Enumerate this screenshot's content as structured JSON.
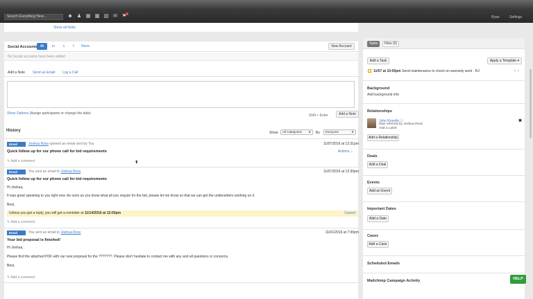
{
  "topbar": {
    "search_placeholder": "Search Everything Here...",
    "icons": [
      "person-add-icon",
      "people-icon",
      "building-icon",
      "briefcase-icon",
      "calendar-icon",
      "mail-icon",
      "notification-icon"
    ],
    "notification_count": "1",
    "user": "Ryan",
    "settings": "Settings"
  },
  "main": {
    "show_all_fields": "Show all fields",
    "social": {
      "title": "Social Accounts",
      "tabs": [
        "All",
        "in",
        "𝕩",
        "f",
        "None"
      ],
      "new_account": "New Account",
      "empty": "No Social accounts have been added"
    },
    "note": {
      "tabs": [
        "Add a Note",
        "Send an Email",
        "Log a Call"
      ],
      "show_options": "Show Options",
      "show_options_rest": "(Assign participants or change the date)",
      "shift_enter": "Shift + Enter",
      "add_note": "Add a Note"
    },
    "history": {
      "title": "History",
      "show_label": "Show",
      "category": "All Categories",
      "by_label": "By",
      "by_value": "Everyone",
      "entries": [
        {
          "badge": "Email",
          "person": "Joshua Ross",
          "action": " opened an email sent by You",
          "date": "11/07/2016 at 12:31pm",
          "subject": "Quick follow up for our phone call for bid requirements",
          "actions": "Actions",
          "comment": "Add a comment"
        },
        {
          "badge": "Email",
          "action_prefix": "You sent an email to ",
          "person": "Joshua Ross",
          "date": "11/07/2016 at 12:30pm",
          "subject": "Quick follow up for our phone call for bid requirements",
          "greeting": "Hi Joshua,",
          "body": "It was great speaking to you right now. As soon as you know what all you require for the bid, please let me know so that we can get the underwriters working on it.",
          "signoff": "Best,",
          "reminder_prefix": "Unless you get a reply, you will get a reminder at ",
          "reminder_date": "11/14/2016 at 12:00pm",
          "reminder_cancel": "Cancel",
          "comment": "Add a comment"
        },
        {
          "badge": "Email",
          "action_prefix": "You sent an email to ",
          "person": "Joshua Ross",
          "date": "11/01/2016 at 7:00pm",
          "subject": "Your bid proposal is finished!",
          "greeting": "Hi Joshua,",
          "body": "Please find the attached PDF with our new proposal for the ???????. Please don't hesitate to contact me with any and all questions or concerns.",
          "signoff": "Best,",
          "comment": "Add a comment"
        }
      ]
    }
  },
  "right": {
    "tabs": [
      "Tasks",
      "Files (0)"
    ],
    "add_task": "Add a Task",
    "apply_template": "Apply a Template",
    "task": {
      "when": "11/07 at 10:00pm",
      "text": " Send maintenance to check on warranty work - RJ"
    },
    "background": {
      "title": "Background",
      "link": "Add background info"
    },
    "relationships": {
      "title": "Relationships",
      "name": "John Rozelle",
      "sub": "Was referred by Joshua Ross",
      "add_label": "Add a Label",
      "add_relationship": "Add a Relationship"
    },
    "deals": {
      "title": "Deals",
      "button": "Add a Deal"
    },
    "events": {
      "title": "Events",
      "button": "Add an Event"
    },
    "important_dates": {
      "title": "Important Dates",
      "button": "Add a Date"
    },
    "cases": {
      "title": "Cases",
      "button": "Add a Case"
    },
    "scheduled_emails": {
      "title": "Scheduled Emails"
    },
    "mailchimp": {
      "title": "Mailchimp Campaign Activity"
    },
    "help": "HELP"
  }
}
